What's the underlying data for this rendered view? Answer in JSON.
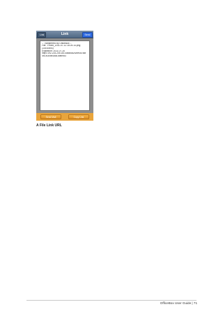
{
  "screen": {
    "nav": {
      "back_label": "Link",
      "title": "Link",
      "send_label": "Send"
    },
    "message_lines": [
      "-- Transferred by OfficeBox --",
      "File: \"Photo_2011-07-11 16.09.14.png",
      "(144.64KB)",
      "Expiration: 2011-07-20",
      "http://192.234.205.16/14a555a2f2be4d788f",
      "4f1043cdb1da14df89d3"
    ],
    "buttons": {
      "left_label": "Send Mail",
      "right_label": "Copy Link"
    }
  },
  "caption": "A File Link URL",
  "footer": "OfficeBox User Guide | 71"
}
